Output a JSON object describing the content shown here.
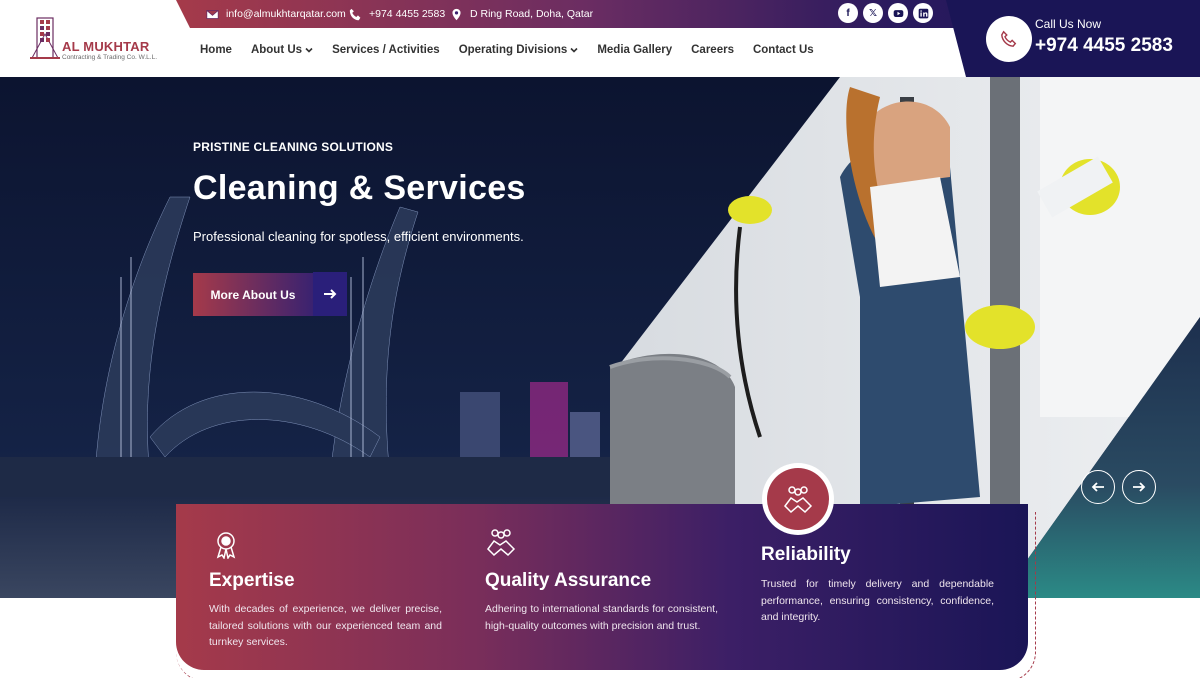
{
  "topbar": {
    "email": "info@almukhtarqatar.com",
    "phone": "+974 4455 2583",
    "address": "D Ring Road, Doha, Qatar",
    "social": [
      {
        "icon": "facebook-icon",
        "glyph": "f"
      },
      {
        "icon": "x-icon",
        "glyph": "𝕏"
      },
      {
        "icon": "youtube-icon",
        "glyph": "▶"
      },
      {
        "icon": "linkedin-icon",
        "glyph": "in"
      }
    ]
  },
  "logo": {
    "name": "AL MUKHTAR",
    "subtitle": "Contracting & Trading Co. W.L.L."
  },
  "nav": {
    "items": [
      {
        "label": "Home",
        "dropdown": false
      },
      {
        "label": "About Us",
        "dropdown": true
      },
      {
        "label": "Services / Activities",
        "dropdown": false
      },
      {
        "label": "Operating Divisions",
        "dropdown": true
      },
      {
        "label": "Media Gallery",
        "dropdown": false
      },
      {
        "label": "Careers",
        "dropdown": false
      },
      {
        "label": "Contact Us",
        "dropdown": false
      }
    ]
  },
  "call": {
    "label": "Call Us Now",
    "number": "+974 4455 2583"
  },
  "hero": {
    "eyebrow": "PRISTINE CLEANING SOLUTIONS",
    "title": "Cleaning & Services",
    "description": "Professional cleaning for spotless, efficient environments.",
    "button_label": "More About Us"
  },
  "features": [
    {
      "icon": "award-ribbon-icon",
      "title": "Expertise",
      "description": "With decades of experience, we deliver precise, tailored solutions with our experienced team and turnkey services."
    },
    {
      "icon": "handshake-icon",
      "title": "Quality Assurance",
      "description": "Adhering to international standards for consistent, high-quality outcomes with precision and trust."
    },
    {
      "icon": "handshake-icon",
      "title": "Reliability",
      "description": "Trusted for timely delivery and dependable performance, ensuring consistency, confidence, and integrity."
    }
  ],
  "colors": {
    "brand_red": "#a53a4a",
    "brand_navy": "#1a1556"
  }
}
